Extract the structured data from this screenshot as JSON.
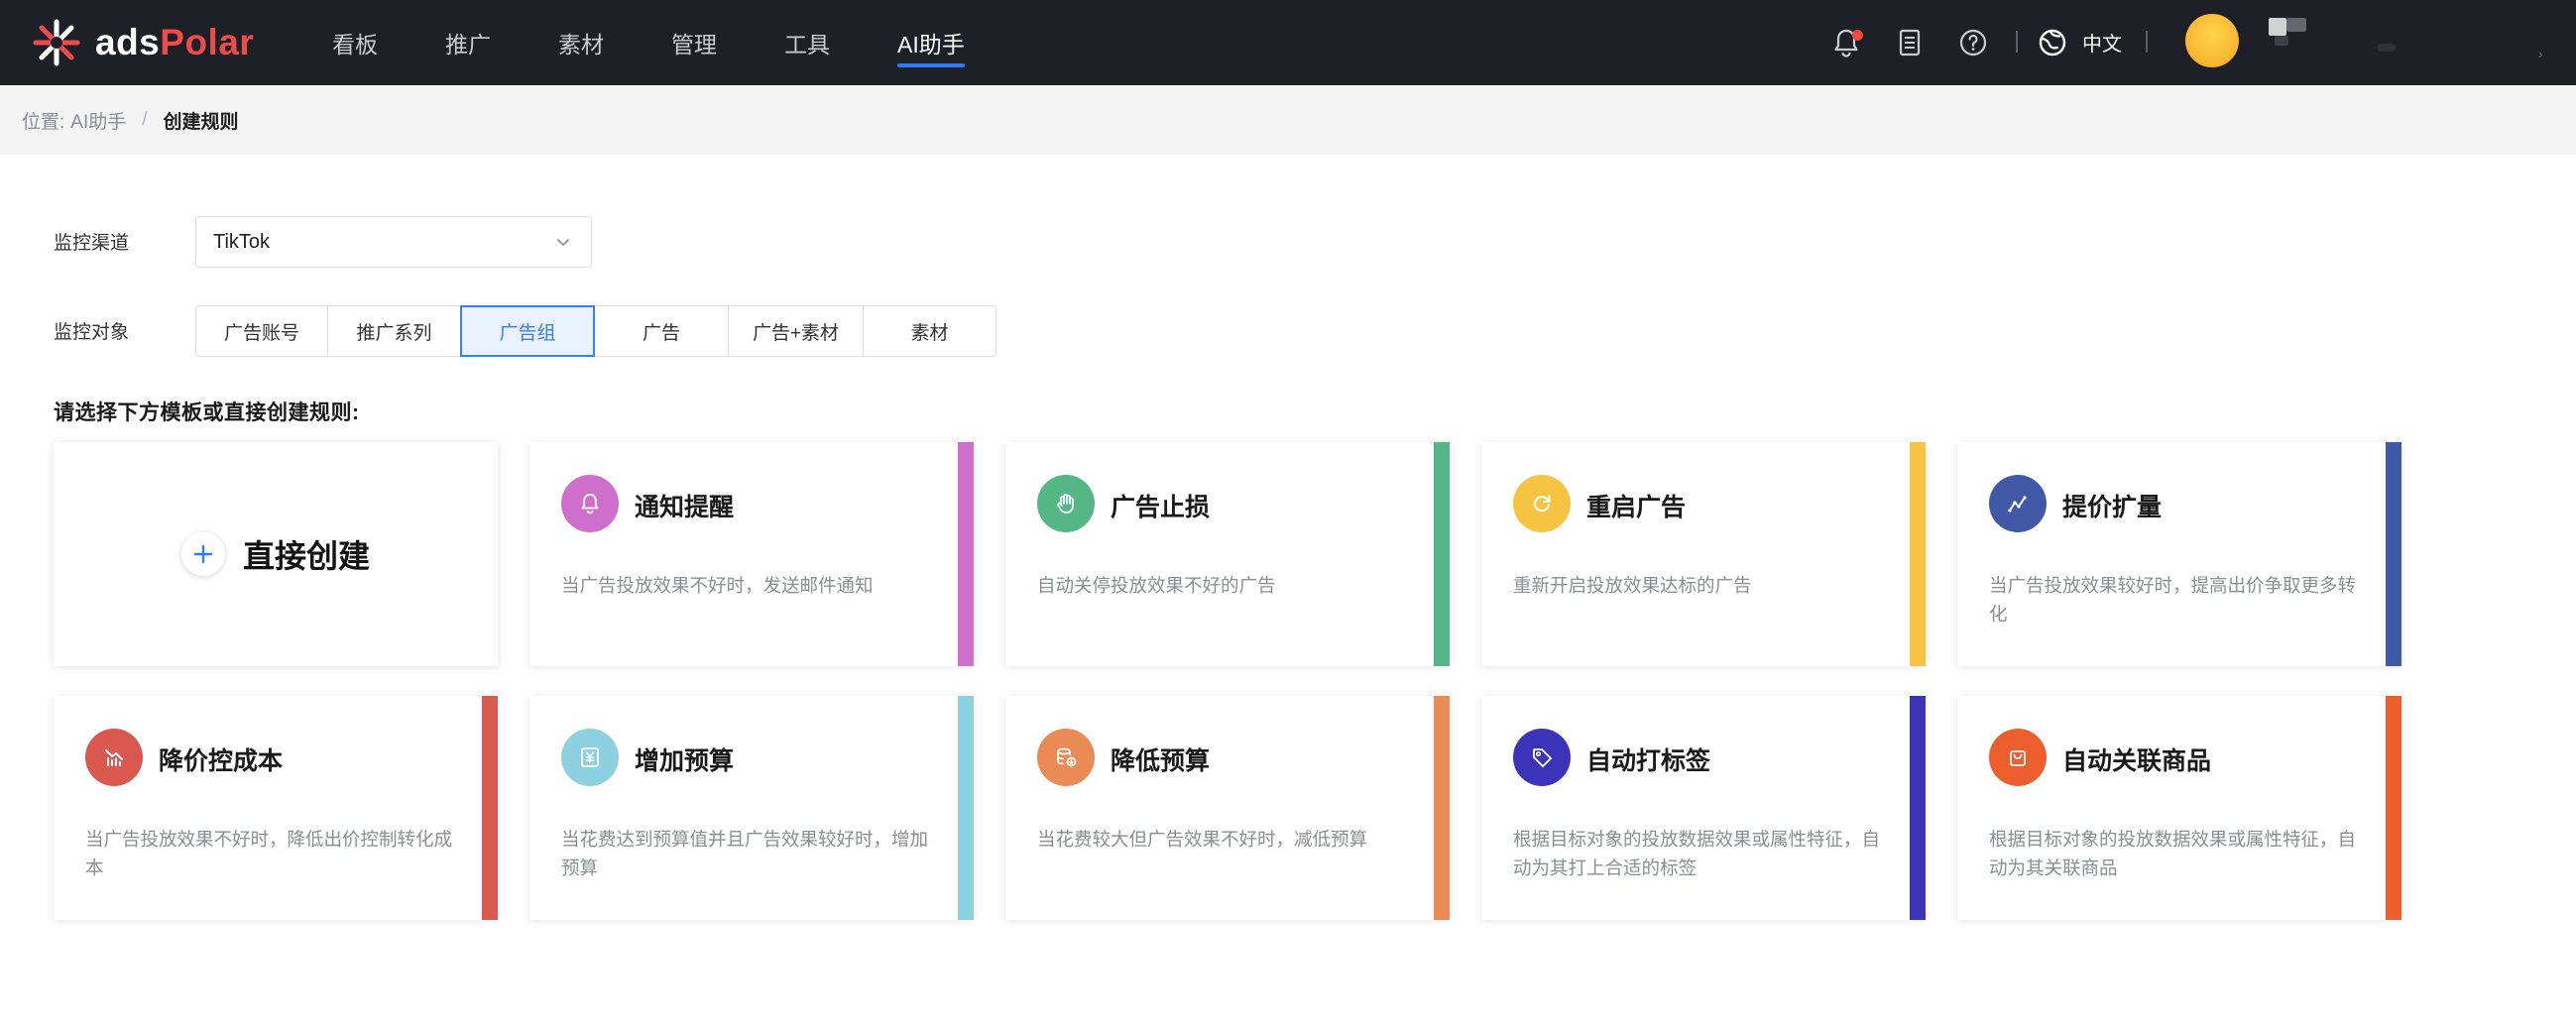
{
  "brand": {
    "name_part1": "ads",
    "name_part2": "Polar"
  },
  "nav": {
    "items": [
      {
        "label": "看板"
      },
      {
        "label": "推广"
      },
      {
        "label": "素材"
      },
      {
        "label": "管理"
      },
      {
        "label": "工具"
      },
      {
        "label": "AI助手"
      }
    ],
    "active_index": 5
  },
  "header_right": {
    "language": "中文"
  },
  "breadcrumb": {
    "prefix": "位置:",
    "parent": "AI助手",
    "separator": "/",
    "current": "创建规则"
  },
  "form": {
    "channel_label": "监控渠道",
    "channel_value": "TikTok",
    "target_label": "监控对象",
    "targets": [
      "广告账号",
      "推广系列",
      "广告组",
      "广告",
      "广告+素材",
      "素材"
    ],
    "active_target_index": 2
  },
  "section_title": "请选择下方模板或直接创建规则:",
  "create_card": {
    "label": "直接创建"
  },
  "templates": [
    {
      "title": "通知提醒",
      "desc": "当广告投放效果不好时，发送邮件通知",
      "icon": "bell-icon",
      "color": "#cf6fcc"
    },
    {
      "title": "广告止损",
      "desc": "自动关停投放效果不好的广告",
      "icon": "hand-stop-icon",
      "color": "#55b686"
    },
    {
      "title": "重启广告",
      "desc": "重新开启投放效果达标的广告",
      "icon": "restart-icon",
      "color": "#f6c343"
    },
    {
      "title": "提价扩量",
      "desc": "当广告投放效果较好时，提高出价争取更多转化",
      "icon": "trend-up-icon",
      "color": "#4058a5"
    },
    {
      "title": "降价控成本",
      "desc": "当广告投放效果不好时，降低出价控制转化成本",
      "icon": "price-down-icon",
      "color": "#d9584f"
    },
    {
      "title": "增加预算",
      "desc": "当花费达到预算值并且广告效果较好时，增加预算",
      "icon": "budget-plus-icon",
      "color": "#8dd0e0"
    },
    {
      "title": "降低预算",
      "desc": "当花费较大但广告效果不好时，减低预算",
      "icon": "budget-down-icon",
      "color": "#ea8a55"
    },
    {
      "title": "自动打标签",
      "desc": "根据目标对象的投放数据效果或属性特征，自动为其打上合适的标签",
      "icon": "tag-icon",
      "color": "#3b33b8"
    },
    {
      "title": "自动关联商品",
      "desc": "根据目标对象的投放数据效果或属性特征，自动为其关联商品",
      "icon": "shopping-bag-icon",
      "color": "#ec5e2d"
    }
  ]
}
